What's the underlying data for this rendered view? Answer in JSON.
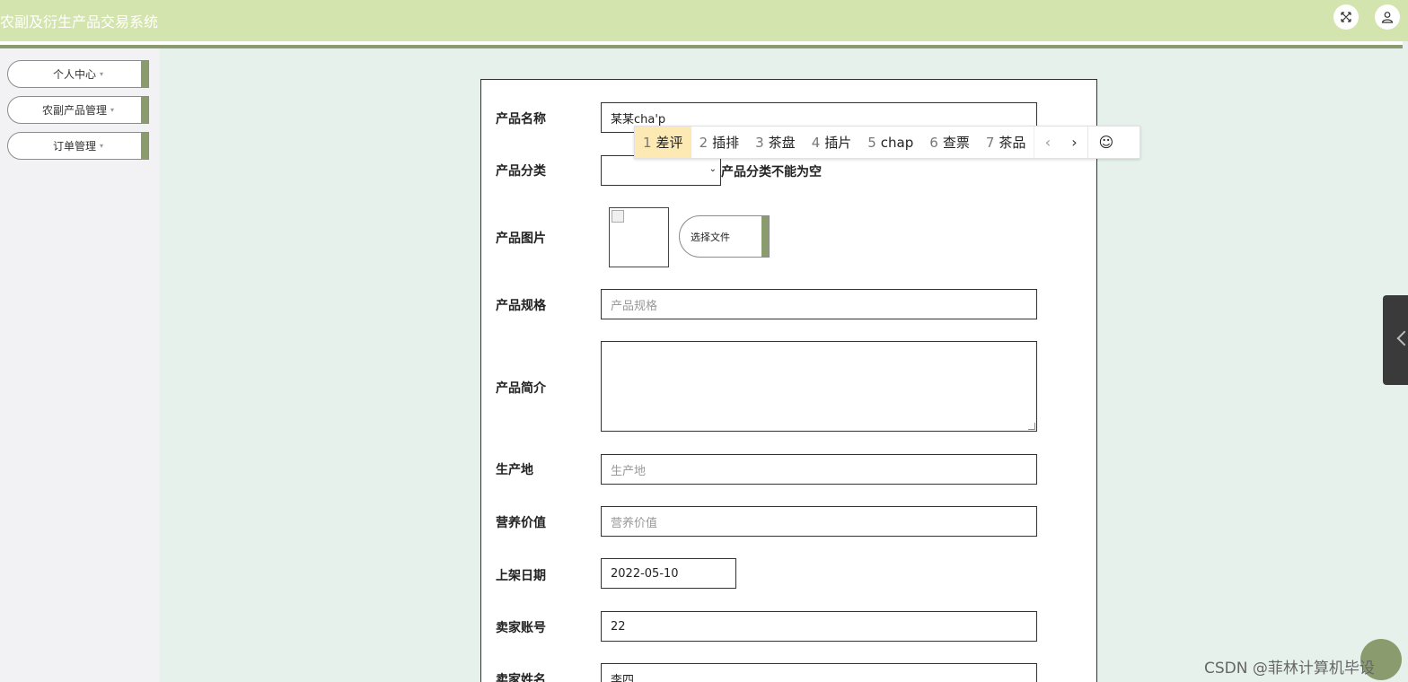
{
  "header": {
    "app_title": "农副及衍生产品交易系统",
    "fullscreen_icon": "fullscreen-icon",
    "user_icon": "user-icon"
  },
  "sidebar": {
    "items": [
      {
        "label": "个人中心",
        "caret": "▾"
      },
      {
        "label": "农副产品管理",
        "caret": "▾"
      },
      {
        "label": "订单管理",
        "caret": "▾"
      }
    ]
  },
  "form": {
    "fields": {
      "name": {
        "label": "产品名称",
        "value": "某某cha'p"
      },
      "category": {
        "label": "产品分类",
        "value": "",
        "error": "产品分类不能为空"
      },
      "image": {
        "label": "产品图片",
        "button_label": "选择文件"
      },
      "spec": {
        "label": "产品规格",
        "placeholder": "产品规格"
      },
      "intro": {
        "label": "产品简介",
        "value": ""
      },
      "origin": {
        "label": "生产地",
        "placeholder": "生产地"
      },
      "nutrition": {
        "label": "营养价值",
        "placeholder": "营养价值"
      },
      "date": {
        "label": "上架日期",
        "value": "2022-05-10"
      },
      "seller_account": {
        "label": "卖家账号",
        "value": "22"
      },
      "seller_name": {
        "label": "卖家姓名",
        "value": "李四"
      }
    }
  },
  "ime": {
    "candidates": [
      {
        "num": "1",
        "text": "差评"
      },
      {
        "num": "2",
        "text": "插排"
      },
      {
        "num": "3",
        "text": "茶盘"
      },
      {
        "num": "4",
        "text": "插片"
      },
      {
        "num": "5",
        "text": "chap"
      },
      {
        "num": "6",
        "text": "查票"
      },
      {
        "num": "7",
        "text": "茶品"
      }
    ],
    "prev": "‹",
    "next": "›",
    "emoji": "☺"
  },
  "watermark": "CSDN @菲林计算机毕设"
}
